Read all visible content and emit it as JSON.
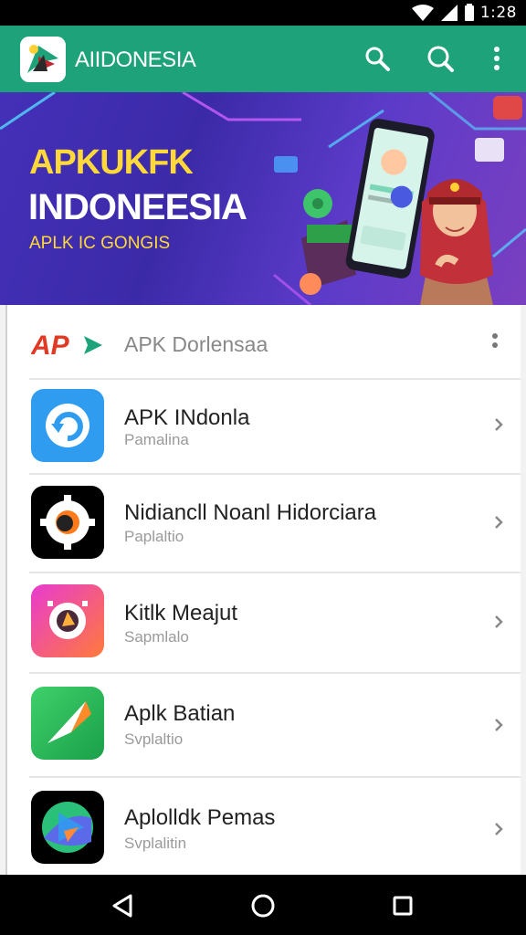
{
  "status_bar": {
    "time": "1:28"
  },
  "app_bar": {
    "title": "AIIDONESIA"
  },
  "banner": {
    "line1": "APKUKFK",
    "line2": "INDONEESIA",
    "line3": "APLK IC GONGIS"
  },
  "list": {
    "header_logo": "AP",
    "header_title": "APK Dorlensaa",
    "items": [
      {
        "title": "APK INdonla",
        "subtitle": "Pamalina"
      },
      {
        "title": "Nidiancll Noanl Hidorciara",
        "subtitle": "Paplaltio"
      },
      {
        "title": "Kitlk Meajut",
        "subtitle": "Sapmlalo"
      },
      {
        "title": "Aplk Batian",
        "subtitle": "Svplaltio"
      },
      {
        "title": "Aplolldk Pemas",
        "subtitle": "Svplalitin"
      }
    ]
  },
  "colors": {
    "app_bar": "#1ea27a",
    "banner_yellow": "#ffd83a",
    "banner_purple": "#4430b8"
  },
  "icons": [
    "search-icon",
    "search-icon",
    "more-vert-icon",
    "back-icon",
    "home-icon",
    "recents-icon"
  ]
}
